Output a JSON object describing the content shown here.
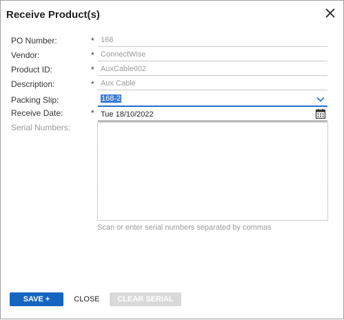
{
  "dialog": {
    "title": "Receive Product(s)"
  },
  "fields": {
    "po_number": {
      "label": "PO Number:",
      "required": "*",
      "value": "168"
    },
    "vendor": {
      "label": "Vendor:",
      "required": "*",
      "value": "ConnectWise"
    },
    "product_id": {
      "label": "Product ID:",
      "required": "*",
      "value": "AuxCable002"
    },
    "description": {
      "label": "Description:",
      "required": "*",
      "value": "Aux Cable"
    },
    "packing_slip": {
      "label": "Packing Slip:",
      "value": "168-2"
    },
    "receive_date": {
      "label": "Receive Date:",
      "required": "*",
      "value": "Tue 18/10/2022"
    },
    "serial_numbers": {
      "label": "Serial Numbers:",
      "hint": "Scan or enter serial numbers separated by commas"
    }
  },
  "buttons": {
    "save_close": "SAVE + CLOSE",
    "close": "CLOSE",
    "clear_serial_list": "CLEAR SERIAL LIST"
  },
  "icons": {
    "close": "close-icon",
    "dropdown": "chevron-down-icon",
    "calendar": "calendar-icon"
  },
  "colors": {
    "accent": "#1565c0",
    "selection": "#3a7bd5",
    "disabled_button": "#d9d9d9"
  }
}
